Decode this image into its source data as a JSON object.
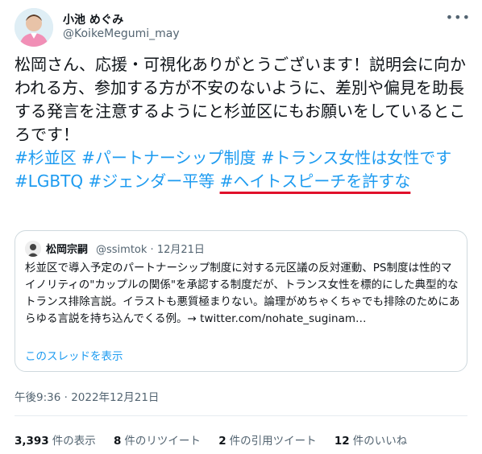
{
  "author": {
    "name": "小池 めぐみ",
    "handle": "@KoikeMegumi_may"
  },
  "more_icon": "more-horizontal-icon",
  "body": {
    "text": "松岡さん、応援・可視化ありがとうございます！説明会に向かわれる方、参加する方が不安のないように、差別や偏見を助長する発言を注意するようにと杉並区にもお願いをしているところです！",
    "hashtags": [
      "#杉並区",
      "#パートナーシップ制度",
      "#トランス女性は女性です",
      "#LGBTQ",
      "#ジェンダー平等",
      "#ヘイトスピーチを許すな"
    ]
  },
  "quote": {
    "name": "松岡宗嗣",
    "handle": "@ssimtok",
    "dot": "·",
    "date": "12月21日",
    "text": "杉並区で導入予定のパートナーシップ制度に対する元区議の反対運動、PS制度は性的マイノリティの\"カップルの関係\"を承認する制度だが、トランス女性を標的にした典型的なトランス排除言説。イラストも悪質極まりない。論理がめちゃくちゃでも排除のためにあらゆる言説を持ち込んでくる例。→ twitter.com/nohate_suginam…",
    "thread_link": "このスレッドを表示"
  },
  "timestamp": "午後9:36 · 2022年12月21日",
  "stats": [
    {
      "count": "3,393",
      "label": "件の表示"
    },
    {
      "count": "8",
      "label": "件のリツイート"
    },
    {
      "count": "2",
      "label": "件の引用ツイート"
    },
    {
      "count": "12",
      "label": "件のいいね"
    }
  ],
  "colors": {
    "link": "#1d9bf0",
    "annotation_underline": "#e0102a"
  }
}
